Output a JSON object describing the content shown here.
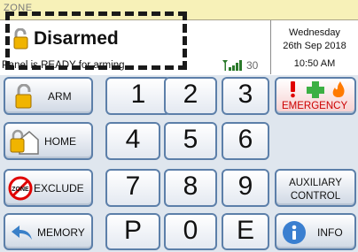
{
  "header": {
    "zone_label": "ZONE",
    "status_title": "Disarmed",
    "status_message": "Panel is READY for arming",
    "signal_strength": "30",
    "day": "Wednesday",
    "date": "26th Sep 2018",
    "time": "10:50 AM"
  },
  "buttons": {
    "arm": "ARM",
    "home": "HOME",
    "exclude": "EXCLUDE",
    "memory": "MEMORY",
    "emergency": "EMERGENCY",
    "auxiliary_line1": "AUXILIARY",
    "auxiliary_line2": "CONTROL",
    "info": "INFO",
    "zone_badge": "ZONE"
  },
  "keys": [
    "1",
    "2",
    "3",
    "4",
    "5",
    "6",
    "7",
    "8",
    "9",
    "P",
    "0",
    "E"
  ],
  "colors": {
    "zone_strip": "#f7f1b8",
    "button_border": "#5c7fa9",
    "keypad_bg": "#dfe6ee",
    "emergency_text": "#cc0000"
  },
  "icons": {
    "arm": "padlock-icon",
    "home": "house-padlock-icon",
    "exclude": "prohibited-zone-icon",
    "memory": "back-arrow-icon",
    "emergency": "alert-medical-fire-icons",
    "info": "info-icon",
    "signal": "signal-bars-icon"
  }
}
